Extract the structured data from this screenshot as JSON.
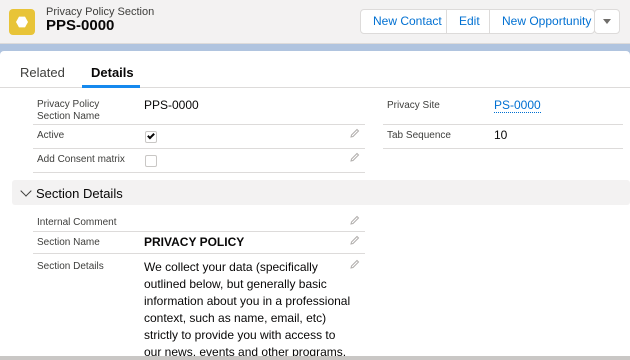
{
  "header": {
    "object_type": "Privacy Policy Section",
    "record_name": "PPS-0000",
    "buttons": {
      "new_contact": "New Contact",
      "edit": "Edit",
      "new_opportunity": "New Opportunity"
    }
  },
  "tabs": {
    "related": "Related",
    "details": "Details",
    "active": "Details"
  },
  "fields": {
    "section_name_label": "Privacy Policy Section Name",
    "section_name_value": "PPS-0000",
    "active_label": "Active",
    "active_checked": true,
    "consent_label": "Add Consent matrix",
    "consent_checked": false,
    "privacy_site_label": "Privacy Site",
    "privacy_site_value": "PS-0000",
    "tab_sequence_label": "Tab Sequence",
    "tab_sequence_value": "10"
  },
  "section_details": {
    "title": "Section Details",
    "internal_comment_label": "Internal Comment",
    "internal_comment_value": "",
    "section_name_label": "Section Name",
    "section_name_value": "PRIVACY POLICY",
    "section_details_label": "Section Details",
    "section_details_lines": [
      "We collect your data (specifically",
      "outlined below, but generally basic",
      "information about you in a professional",
      "context, such as name, email, etc)",
      "strictly to provide you with access to",
      "our news, events and other programs."
    ]
  },
  "colors": {
    "brand_blue": "#0070d2",
    "icon_yellow": "#e8c438",
    "tab_accent": "#1589ee"
  }
}
